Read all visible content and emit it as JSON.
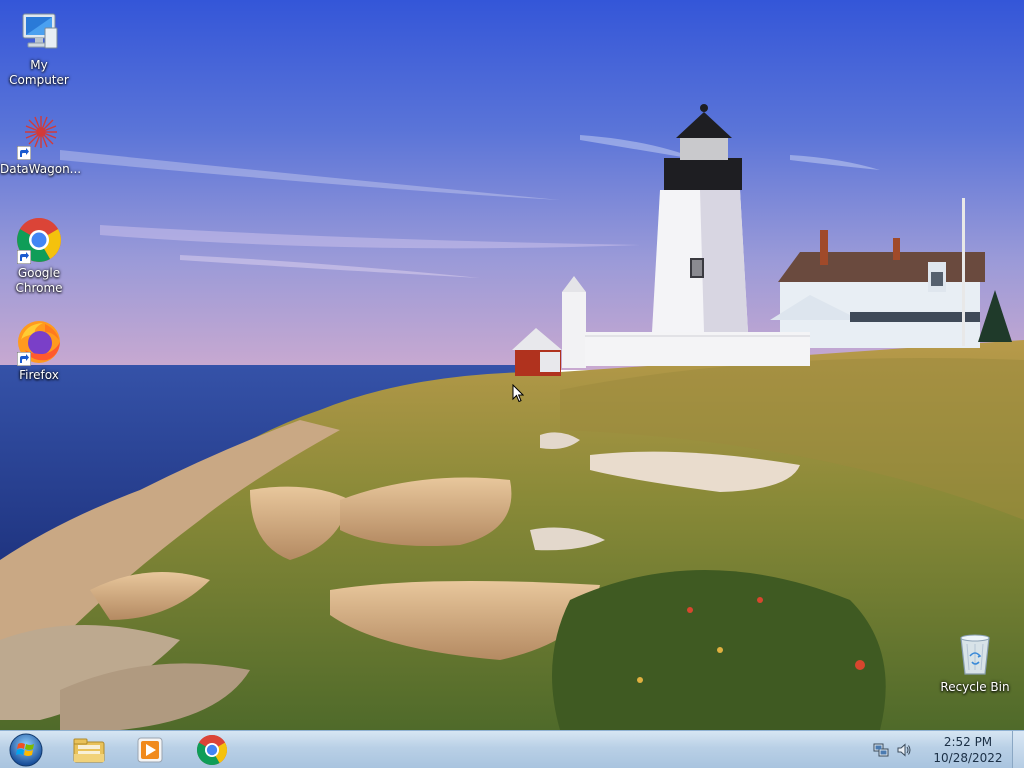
{
  "desktop": {
    "icons": [
      {
        "label": "My Computer",
        "icon": "computer-icon"
      },
      {
        "label": "DataWagon...",
        "icon": "datawagon-icon",
        "shortcut": true
      },
      {
        "label": "Google\nChrome",
        "icon": "chrome-icon",
        "shortcut": true
      },
      {
        "label": "Firefox",
        "icon": "firefox-icon",
        "shortcut": true
      },
      {
        "label": "Recycle Bin",
        "icon": "recycle-bin-icon"
      }
    ]
  },
  "taskbar": {
    "start_icon": "windows-start-icon",
    "pinned": [
      {
        "icon": "file-explorer-icon"
      },
      {
        "icon": "media-player-icon"
      },
      {
        "icon": "chrome-icon"
      }
    ],
    "tray": {
      "network_icon": "network-icon",
      "volume_icon": "volume-icon",
      "time": "2:52 PM",
      "date": "10/28/2022"
    }
  },
  "colors": {
    "taskbar_top": "#d7e6f3",
    "taskbar_bottom": "#a9c4df",
    "sky_top": "#3b5bd6",
    "sea": "#2d4aa0"
  }
}
